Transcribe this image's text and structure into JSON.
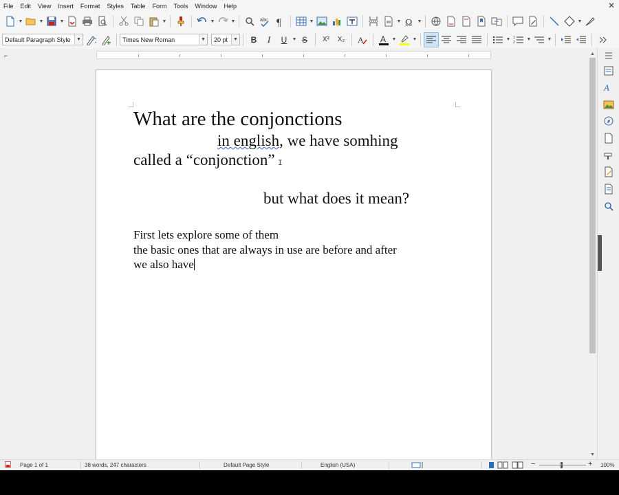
{
  "menu": [
    "File",
    "Edit",
    "View",
    "Insert",
    "Format",
    "Styles",
    "Table",
    "Form",
    "Tools",
    "Window",
    "Help"
  ],
  "formatting": {
    "paragraph_style": "Default Paragraph Style",
    "font_name": "Times New Roman",
    "font_size": "20 pt",
    "bold": "B",
    "italic": "I",
    "underline": "U",
    "strike": "S",
    "superscript": "X²",
    "subscript": "X₂"
  },
  "document": {
    "line1": "What are the conjonctions",
    "line2a": "in english",
    "line2b": ", we have somhing",
    "line3": "called a “conjonction”",
    "line4": "but what does it mean?",
    "line5": "First lets explore some of them",
    "line6": "the basic ones that are always in use are before and after",
    "line7": "we also have"
  },
  "status": {
    "page": "Page 1 of 1",
    "words": "38 words, 247 characters",
    "page_style": "Default Page Style",
    "language": "English (USA)",
    "zoom": "100%"
  },
  "colors": {
    "font_color": "#c9211e",
    "highlight": "#ffff00",
    "accent": "#2a6ebb"
  }
}
